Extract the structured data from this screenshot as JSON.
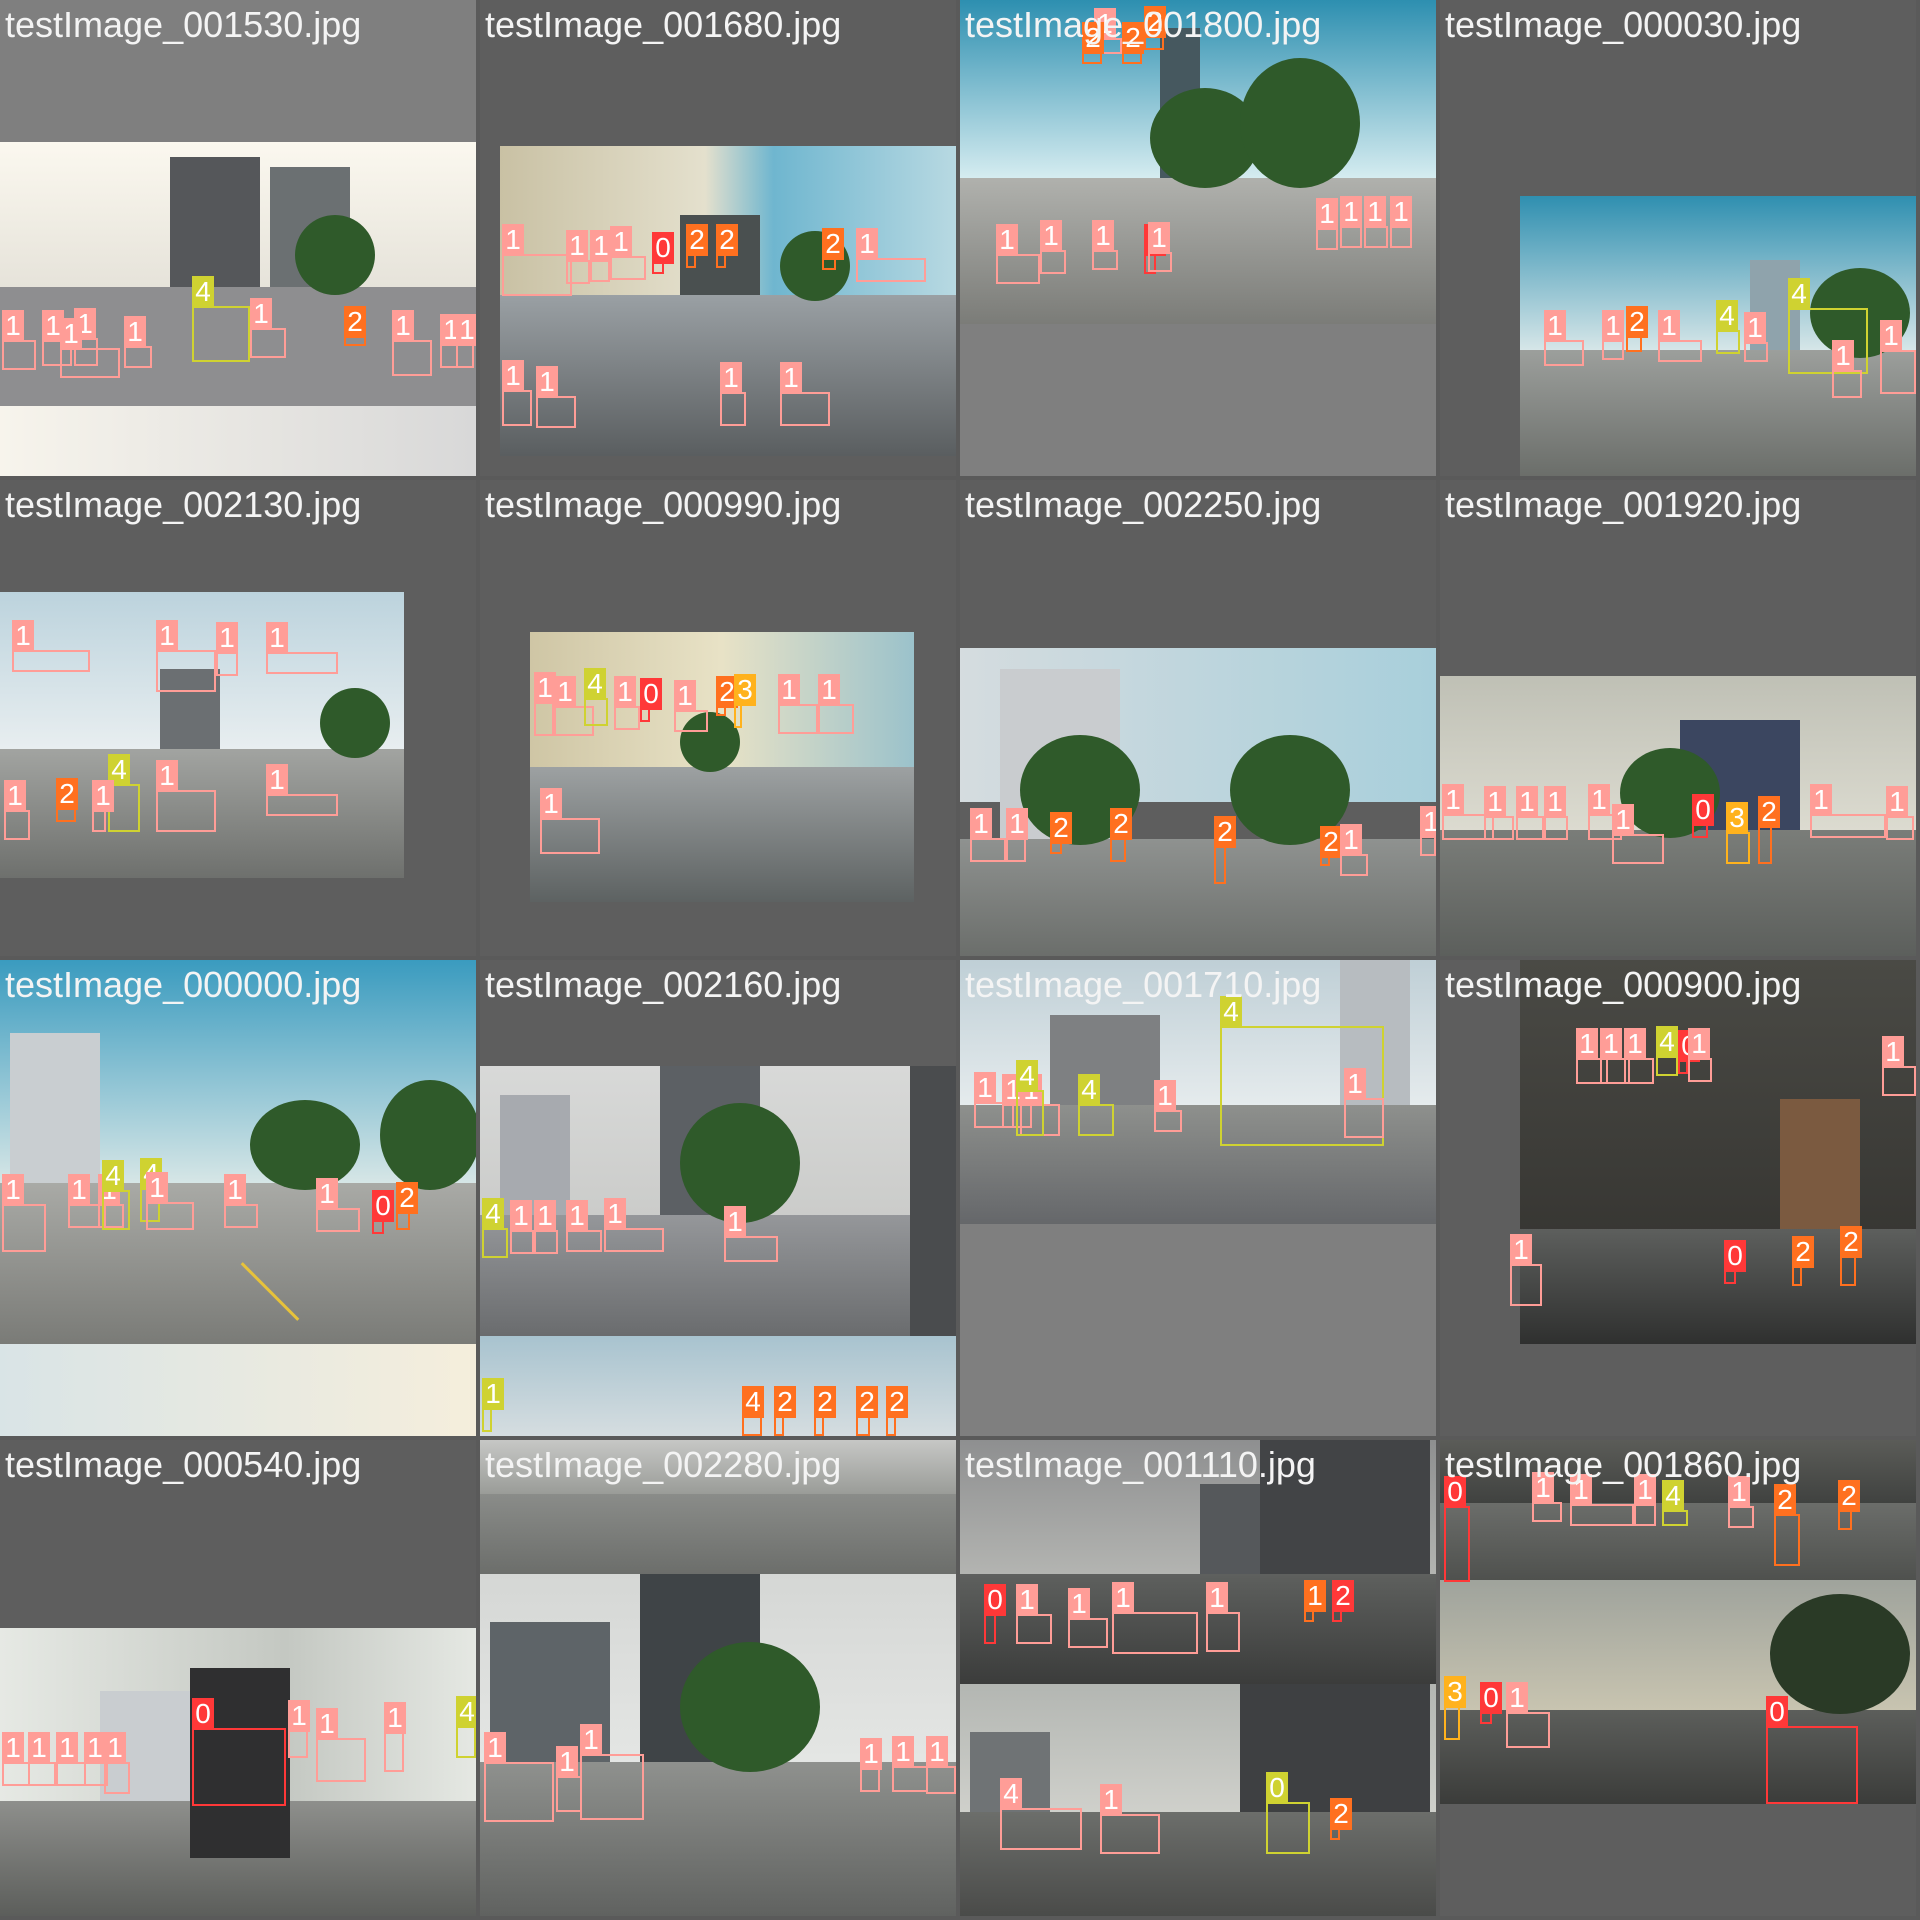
{
  "mosaic": {
    "tiles": [
      {
        "filename": "testImage_001530.jpg",
        "labels": [
          "1",
          "1",
          "1",
          "1",
          "1",
          "4",
          "1",
          "2",
          "1",
          "1",
          "1"
        ]
      },
      {
        "filename": "testImage_001680.jpg",
        "labels": [
          "1",
          "1",
          "1",
          "1",
          "0",
          "2",
          "2",
          "2",
          "1",
          "1",
          "1",
          "1",
          "1"
        ]
      },
      {
        "filename": "testImage_001800.jpg",
        "labels": [
          "1",
          "1",
          "1",
          "1",
          "0",
          "2",
          "2",
          "2",
          "1",
          "1",
          "1",
          "1",
          "1"
        ]
      },
      {
        "filename": "testImage_000030.jpg",
        "labels": [
          "1",
          "1",
          "2",
          "1",
          "4",
          "4",
          "1",
          "1",
          "1"
        ]
      },
      {
        "filename": "testImage_002130.jpg",
        "labels": [
          "1",
          "1",
          "1",
          "1",
          "1",
          "1",
          "2",
          "4",
          "1",
          "1"
        ]
      },
      {
        "filename": "testImage_000990.jpg",
        "labels": [
          "1",
          "1",
          "4",
          "1",
          "0",
          "1",
          "2",
          "3",
          "1",
          "1",
          "1"
        ]
      },
      {
        "filename": "testImage_002250.jpg",
        "labels": [
          "1",
          "1",
          "2",
          "2",
          "2",
          "2",
          "1",
          "1"
        ]
      },
      {
        "filename": "testImage_001920.jpg",
        "labels": [
          "1",
          "1",
          "1",
          "1",
          "1",
          "1",
          "0",
          "3",
          "2",
          "1",
          "1"
        ]
      },
      {
        "filename": "testImage_000000.jpg",
        "labels": [
          "1",
          "1",
          "1",
          "4",
          "4",
          "1",
          "1",
          "1",
          "0",
          "2"
        ]
      },
      {
        "filename": "testImage_002160.jpg",
        "labels": [
          "4",
          "1",
          "1",
          "1",
          "1",
          "1",
          "1",
          "4",
          "2",
          "2",
          "2",
          "2"
        ]
      },
      {
        "filename": "testImage_001710.jpg",
        "labels": [
          "1",
          "1",
          "1",
          "4",
          "4",
          "1",
          "4",
          "1"
        ]
      },
      {
        "filename": "testImage_000900.jpg",
        "labels": [
          "1",
          "1",
          "1",
          "4",
          "0",
          "1",
          "1",
          "0",
          "2",
          "2",
          "1"
        ]
      },
      {
        "filename": "testImage_000540.jpg",
        "labels": [
          "1",
          "1",
          "1",
          "1",
          "1",
          "0",
          "1",
          "1",
          "1",
          "4"
        ]
      },
      {
        "filename": "testImage_002280.jpg",
        "labels": [
          "1",
          "1",
          "1",
          "1",
          "1",
          "1"
        ]
      },
      {
        "filename": "testImage_001110.jpg",
        "labels": [
          "0",
          "1",
          "1",
          "1",
          "1",
          "1",
          "2",
          "0",
          "4",
          "1",
          "2"
        ]
      },
      {
        "filename": "testImage_001860.jpg",
        "labels": [
          "0",
          "1",
          "1",
          "1",
          "4",
          "1",
          "2",
          "2",
          "3",
          "0",
          "1",
          "0"
        ]
      }
    ]
  },
  "class_colors": {
    "0": "#ff3838",
    "1": "#ff9d97",
    "2": "#ff701f",
    "3": "#ffb21d",
    "4": "#cfd231"
  }
}
